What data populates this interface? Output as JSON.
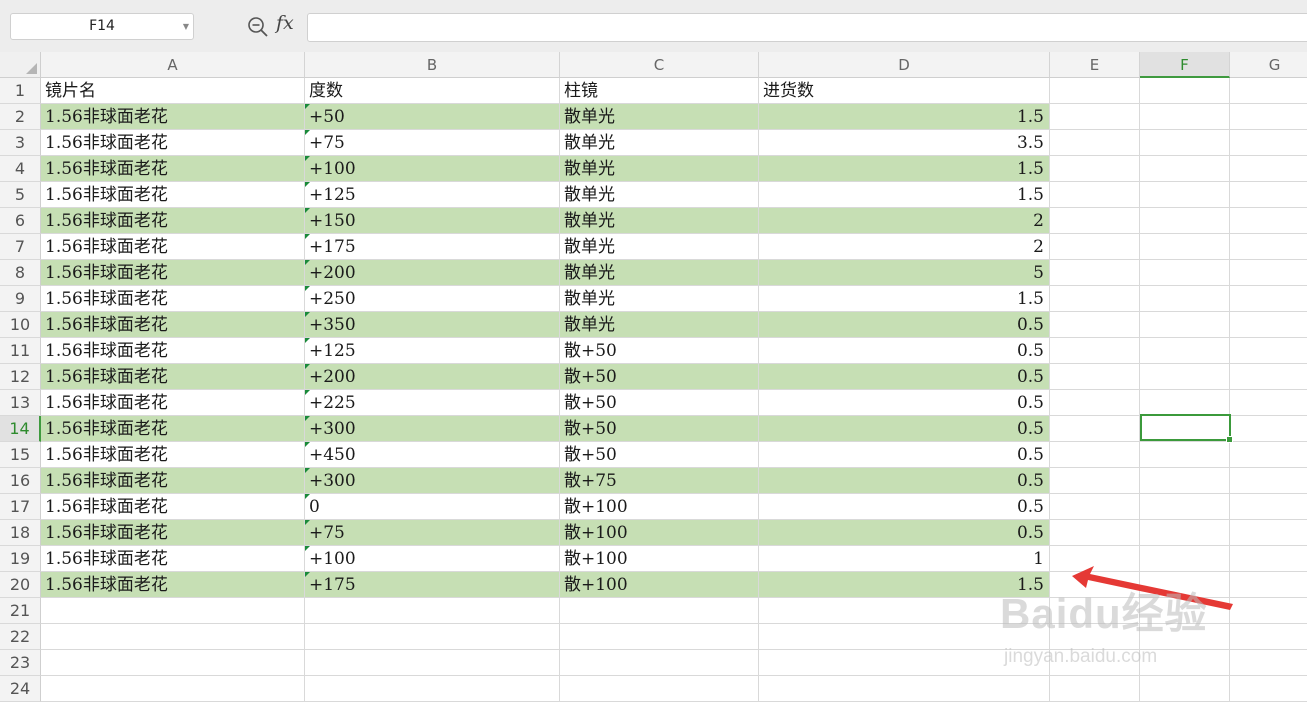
{
  "formula_bar": {
    "cell_ref": "F14",
    "fx_label": "fx",
    "formula": ""
  },
  "columns": [
    "A",
    "B",
    "C",
    "D",
    "E",
    "F",
    "G"
  ],
  "active_column": "F",
  "active_row": 14,
  "rows": [
    {
      "n": "1",
      "a": "镜片名",
      "b": "度数",
      "c": "柱镜",
      "d": "进货数"
    },
    {
      "n": "2",
      "a": "1.56非球面老花",
      "b": "+50",
      "c": "散单光",
      "d": "1.5"
    },
    {
      "n": "3",
      "a": "1.56非球面老花",
      "b": "+75",
      "c": "散单光",
      "d": "3.5"
    },
    {
      "n": "4",
      "a": "1.56非球面老花",
      "b": "+100",
      "c": "散单光",
      "d": "1.5"
    },
    {
      "n": "5",
      "a": "1.56非球面老花",
      "b": "+125",
      "c": "散单光",
      "d": "1.5"
    },
    {
      "n": "6",
      "a": "1.56非球面老花",
      "b": "+150",
      "c": "散单光",
      "d": "2"
    },
    {
      "n": "7",
      "a": "1.56非球面老花",
      "b": "+175",
      "c": "散单光",
      "d": "2"
    },
    {
      "n": "8",
      "a": "1.56非球面老花",
      "b": "+200",
      "c": "散单光",
      "d": "5"
    },
    {
      "n": "9",
      "a": "1.56非球面老花",
      "b": "+250",
      "c": "散单光",
      "d": "1.5"
    },
    {
      "n": "10",
      "a": "1.56非球面老花",
      "b": "+350",
      "c": "散单光",
      "d": "0.5"
    },
    {
      "n": "11",
      "a": "1.56非球面老花",
      "b": "+125",
      "c": "散+50",
      "d": "0.5"
    },
    {
      "n": "12",
      "a": "1.56非球面老花",
      "b": "+200",
      "c": "散+50",
      "d": "0.5"
    },
    {
      "n": "13",
      "a": "1.56非球面老花",
      "b": "+225",
      "c": "散+50",
      "d": "0.5"
    },
    {
      "n": "14",
      "a": "1.56非球面老花",
      "b": "+300",
      "c": "散+50",
      "d": "0.5"
    },
    {
      "n": "15",
      "a": "1.56非球面老花",
      "b": "+450",
      "c": "散+50",
      "d": "0.5"
    },
    {
      "n": "16",
      "a": "1.56非球面老花",
      "b": "+300",
      "c": "散+75",
      "d": "0.5"
    },
    {
      "n": "17",
      "a": "1.56非球面老花",
      "b": "0",
      "c": "散+100",
      "d": "0.5"
    },
    {
      "n": "18",
      "a": "1.56非球面老花",
      "b": "+75",
      "c": "散+100",
      "d": "0.5"
    },
    {
      "n": "19",
      "a": "1.56非球面老花",
      "b": "+100",
      "c": "散+100",
      "d": "1"
    },
    {
      "n": "20",
      "a": "1.56非球面老花",
      "b": "+175",
      "c": "散+100",
      "d": "1.5"
    },
    {
      "n": "21",
      "a": "",
      "b": "",
      "c": "",
      "d": ""
    },
    {
      "n": "22",
      "a": "",
      "b": "",
      "c": "",
      "d": ""
    },
    {
      "n": "23",
      "a": "",
      "b": "",
      "c": "",
      "d": ""
    },
    {
      "n": "24",
      "a": "",
      "b": "",
      "c": "",
      "d": ""
    }
  ],
  "colors": {
    "band_fill": "#c6dfb4",
    "selection": "#3b9a3b",
    "arrow": "#e53935"
  },
  "watermark": {
    "main": "Baidu经验",
    "sub": "jingyan.baidu.com"
  }
}
